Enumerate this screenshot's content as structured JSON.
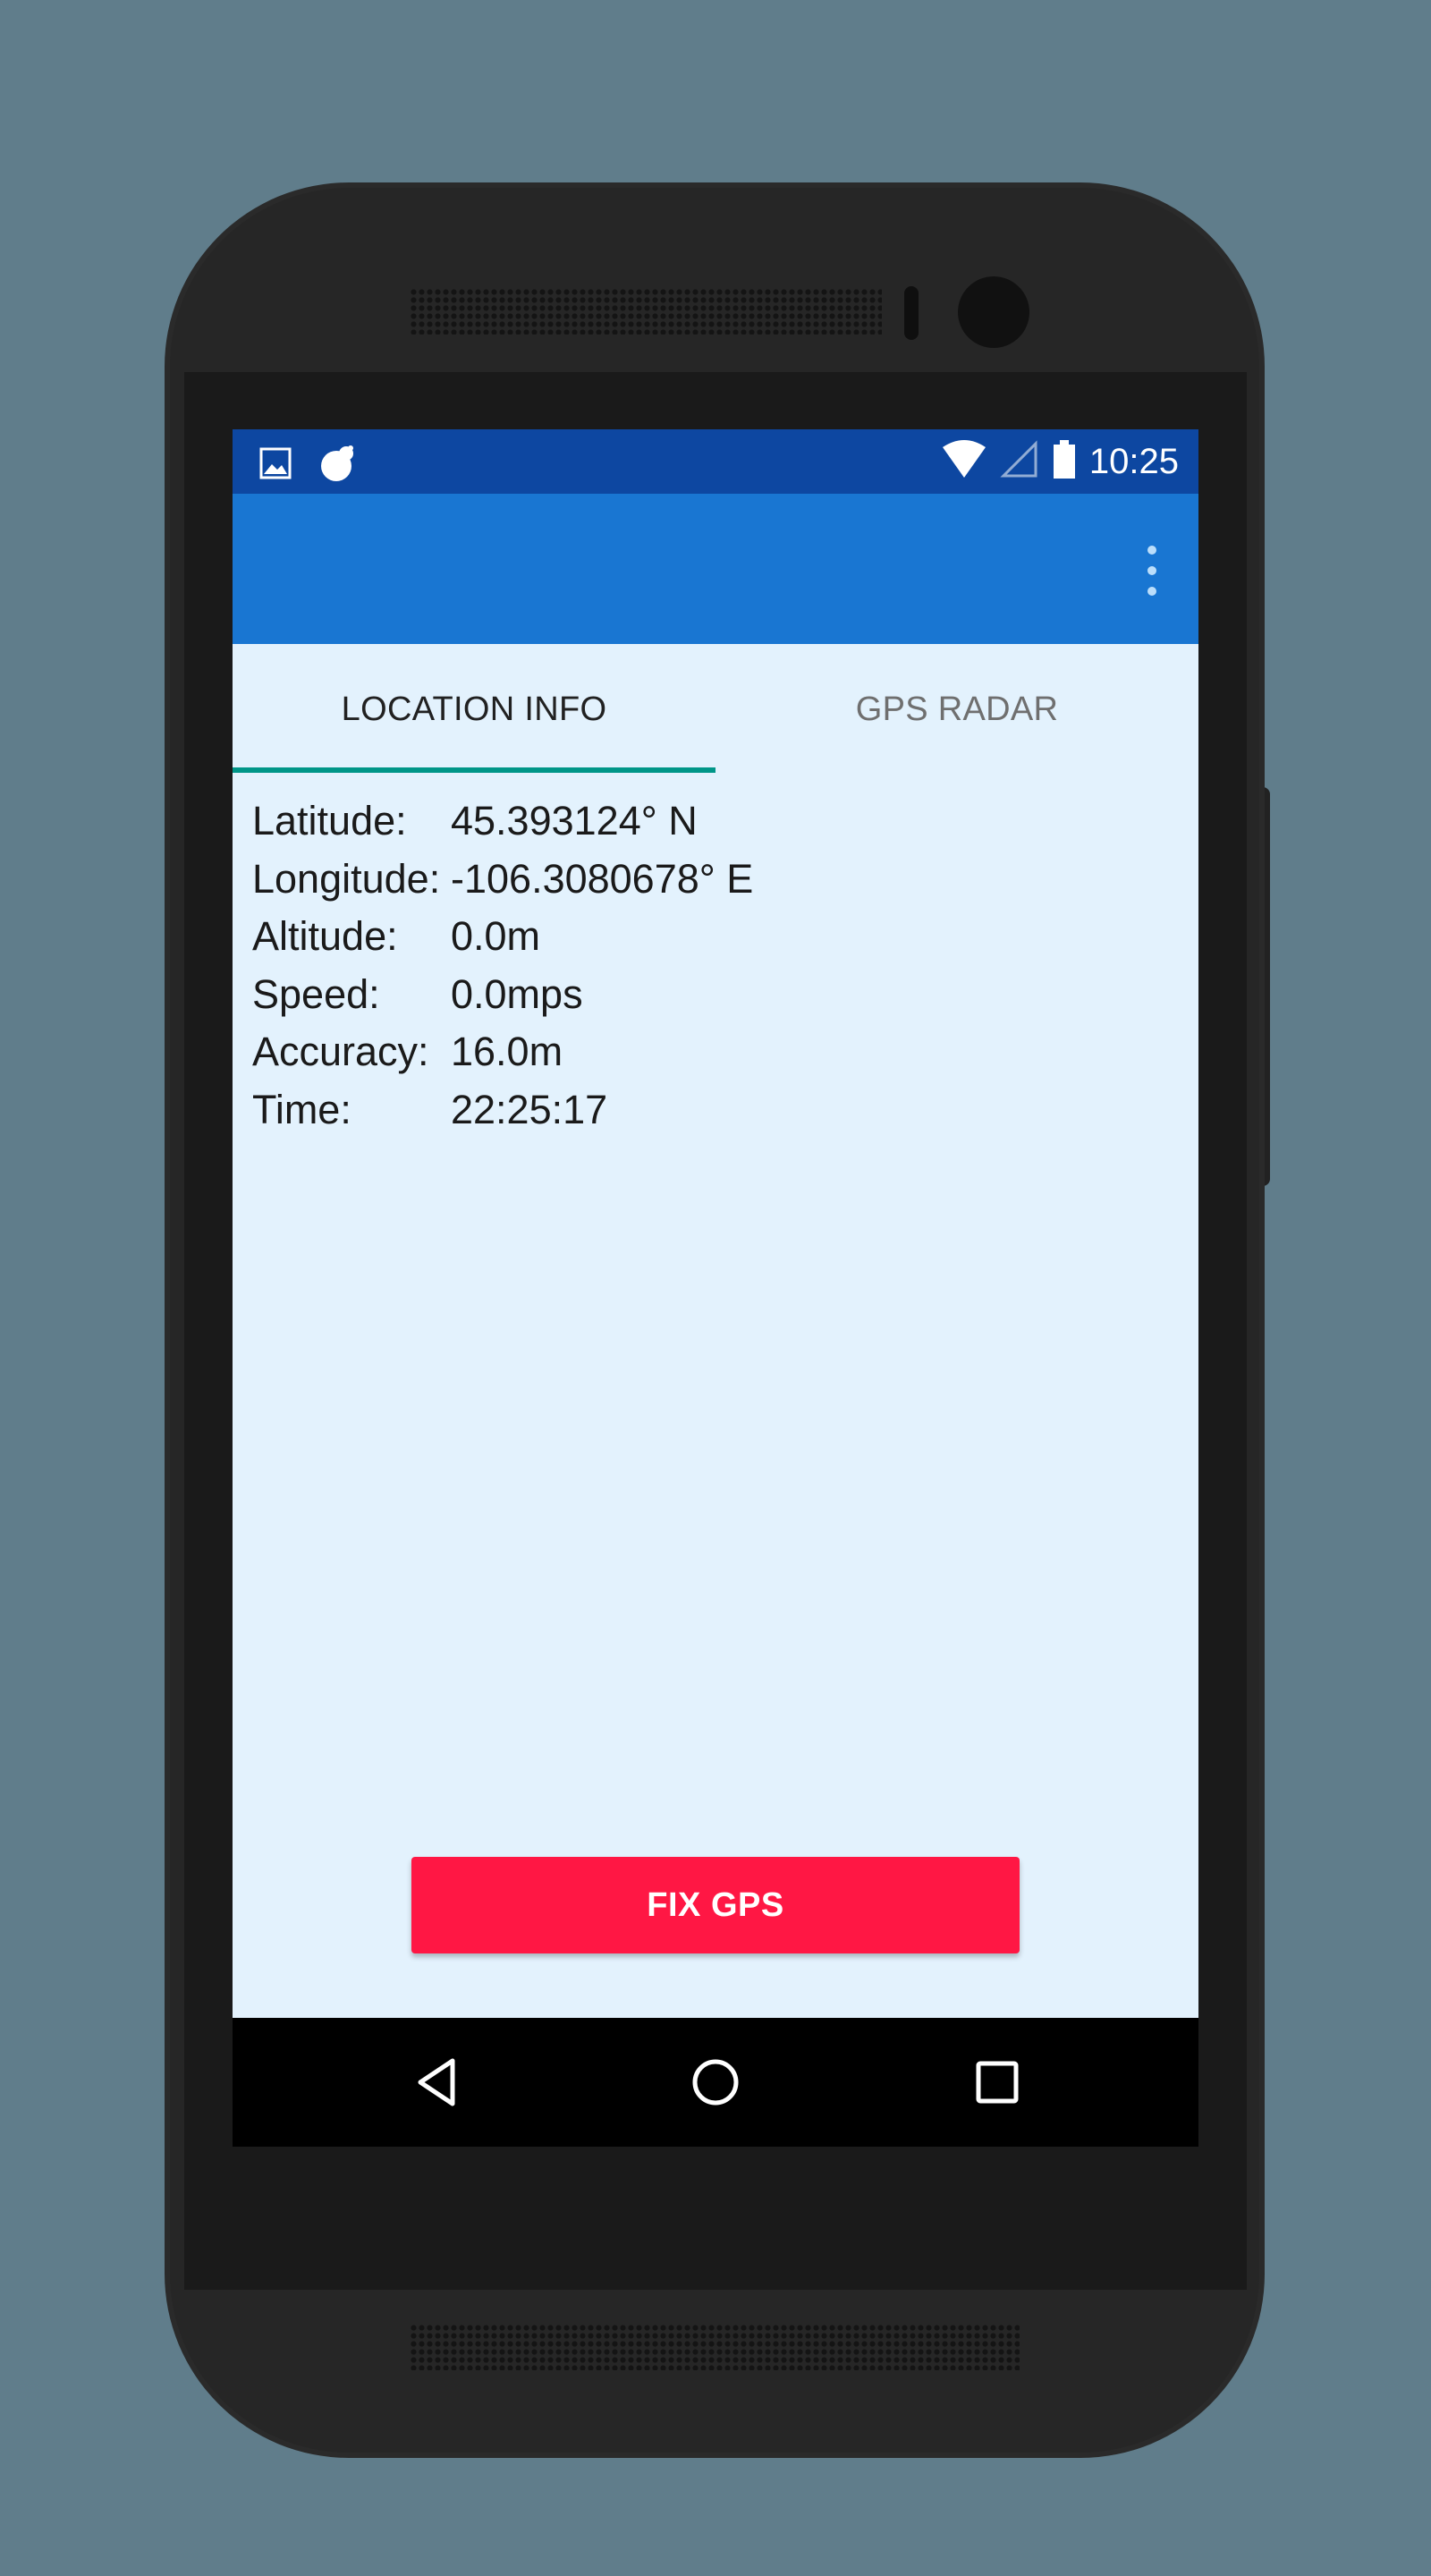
{
  "status_bar": {
    "left_icons": [
      "image-icon",
      "app-notification-icon"
    ],
    "right_icons": [
      "wifi-icon",
      "cell-signal-icon",
      "battery-icon"
    ],
    "time": "10:25"
  },
  "app_bar": {
    "menu_icon": "more-vert-icon"
  },
  "tabs": [
    {
      "label": "LOCATION INFO",
      "active": true
    },
    {
      "label": "GPS RADAR",
      "active": false
    }
  ],
  "location_info": [
    {
      "label": "Latitude:",
      "value": "45.393124° N"
    },
    {
      "label": "Longitude:",
      "value": "-106.3080678° E"
    },
    {
      "label": "Altitude:",
      "value": "0.0m"
    },
    {
      "label": "Speed:",
      "value": "0.0mps"
    },
    {
      "label": "Accuracy:",
      "value": "16.0m"
    },
    {
      "label": "Time:",
      "value": "22:25:17"
    }
  ],
  "fix_button": {
    "label": "FIX GPS"
  },
  "nav_bar": {
    "back": "back-icon",
    "home": "home-icon",
    "recents": "recents-icon"
  },
  "colors": {
    "status_bar": "#0d47a1",
    "app_bar": "#1976d2",
    "content_bg": "#e3f2fd",
    "tab_indicator": "#009688",
    "accent_button": "#ff1744"
  }
}
